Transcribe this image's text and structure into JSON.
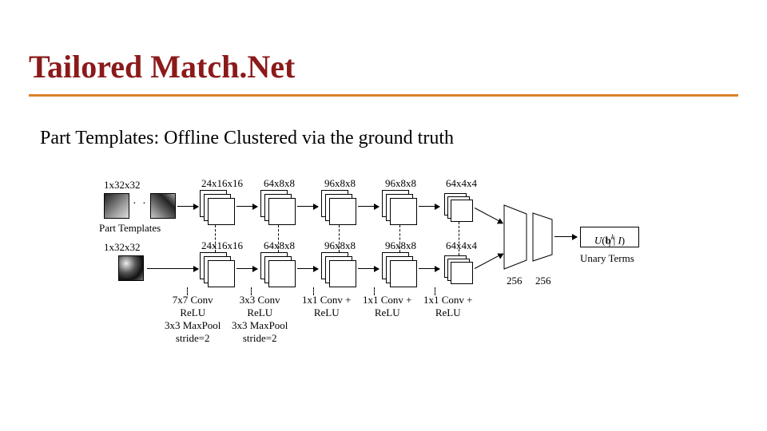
{
  "title": "Tailored Match.Net",
  "subtitle": "Part Templates: Offline Clustered via the ground truth",
  "inputs": {
    "top_label": "1x32x32",
    "part_templates_label": "Part Templates",
    "bottom_label": "1x32x32"
  },
  "feature_maps": [
    "24x16x16",
    "64x8x8",
    "96x8x8",
    "96x8x8",
    "64x4x4"
  ],
  "conv_blocks": [
    "7x7 Conv\nReLU\n3x3 MaxPool\nstride=2",
    "3x3 Conv\nReLU\n3x3 MaxPool\nstride=2",
    "1x1 Conv +\nReLU",
    "1x1 Conv +\nReLU",
    "1x1 Conv +\nReLU"
  ],
  "fc_labels": [
    "256",
    "256"
  ],
  "output": {
    "formula_plain": "U(b_i^k | I)",
    "label": "Unary Terms"
  },
  "ellipsis": "· · ·"
}
